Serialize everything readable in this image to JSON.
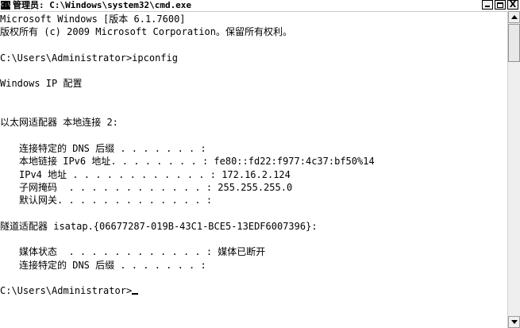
{
  "window": {
    "title": "管理员: C:\\Windows\\system32\\cmd.exe",
    "icon": "cmd-icon",
    "icon_text": "C:\\",
    "controls": {
      "close_label": "X"
    }
  },
  "console": {
    "lines": {
      "l0": "Microsoft Windows [版本 6.1.7600]",
      "l1": "版权所有 (c) 2009 Microsoft Corporation。保留所有权利。",
      "l3": "C:\\Users\\Administrator>ipconfig",
      "l5": "Windows IP 配置",
      "l8": "以太网适配器 本地连接 2:",
      "l10": "连接特定的 DNS 后缀 . . . . . . . :",
      "l11": "本地链接 IPv6 地址. . . . . . . . : fe80::fd22:f977:4c37:bf50%14",
      "l12": "IPv4 地址 . . . . . . . . . . . . : 172.16.2.124",
      "l13": "子网掩码  . . . . . . . . . . . . : 255.255.255.0",
      "l14": "默认网关. . . . . . . . . . . . . :",
      "l16": "隧道适配器 isatap.{06677287-019B-43C1-BCE5-13EDF6007396}:",
      "l18": "媒体状态  . . . . . . . . . . . . : 媒体已断开",
      "l19": "连接特定的 DNS 后缀 . . . . . . . :",
      "l21": "C:\\Users\\Administrator>"
    }
  }
}
